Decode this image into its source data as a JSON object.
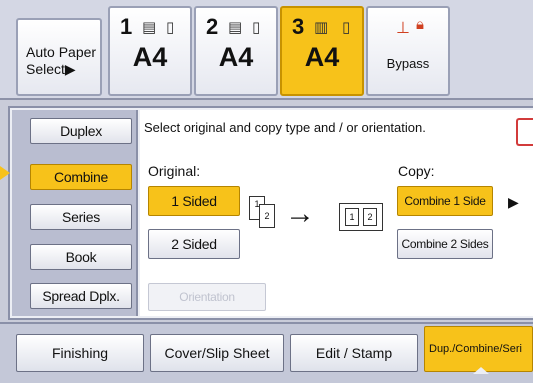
{
  "trays": {
    "auto": {
      "line1": "Auto Paper",
      "line2": "Select▶"
    },
    "items": [
      {
        "number": "1",
        "size": "A4"
      },
      {
        "number": "2",
        "size": "A4"
      },
      {
        "number": "3",
        "size": "A4",
        "selected": true
      }
    ],
    "bypass": {
      "label": "Bypass",
      "icon": "bypass-tray-icon"
    }
  },
  "sidebar": {
    "items": [
      "Duplex",
      "Combine",
      "Series",
      "Book",
      "Spread Dplx."
    ],
    "selected": "Combine"
  },
  "instruction": "Select original and copy type and / or orientation.",
  "original": {
    "label": "Original:",
    "options": [
      "1 Sided",
      "2 Sided"
    ],
    "selected": "1 Sided",
    "orientation_button": "Orientation"
  },
  "diagram": {
    "source_pages": [
      "1",
      "2"
    ],
    "result_pages": [
      "1",
      "2"
    ],
    "arrow": "→"
  },
  "copy": {
    "label": "Copy:",
    "options": [
      "Combine 1 Side",
      "Combine 2 Sides"
    ],
    "selected": "Combine 1 Side",
    "more": "▶"
  },
  "tabs": [
    "Finishing",
    "Cover/Slip Sheet",
    "Edit / Stamp",
    "Dup./Combine/Seri"
  ],
  "active_tab": "Dup./Combine/Seri",
  "colors": {
    "accent": "#f7c21a",
    "help_border": "#d23b3b"
  }
}
